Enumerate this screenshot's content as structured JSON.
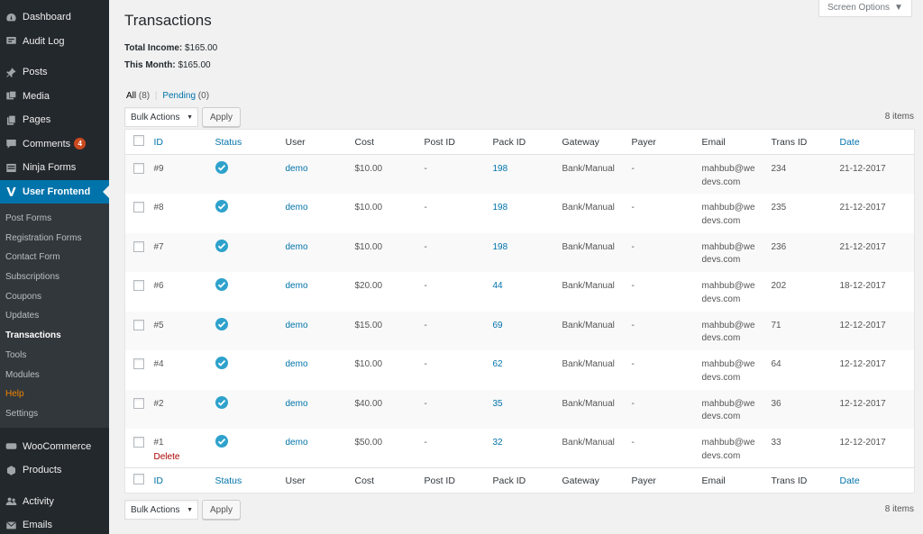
{
  "sidebar": {
    "items_top": [
      {
        "label": "Dashboard",
        "icon": "dashboard-icon"
      },
      {
        "label": "Audit Log",
        "icon": "audit-log-icon"
      }
    ],
    "items_mid": [
      {
        "label": "Posts",
        "icon": "pin-icon"
      },
      {
        "label": "Media",
        "icon": "media-icon"
      },
      {
        "label": "Pages",
        "icon": "pages-icon"
      },
      {
        "label": "Comments",
        "icon": "comment-icon",
        "badge": "4"
      },
      {
        "label": "Ninja Forms",
        "icon": "form-icon"
      },
      {
        "label": "User Frontend",
        "icon": "user-frontend-icon"
      }
    ],
    "submenu": [
      "Post Forms",
      "Registration Forms",
      "Contact Form",
      "Subscriptions",
      "Coupons",
      "Updates",
      "Transactions",
      "Tools",
      "Modules",
      "Help",
      "Settings"
    ],
    "items_bottom": [
      {
        "label": "WooCommerce",
        "icon": "woocommerce-icon"
      },
      {
        "label": "Products",
        "icon": "products-icon"
      }
    ],
    "items_end": [
      {
        "label": "Activity",
        "icon": "activity-icon"
      },
      {
        "label": "Emails",
        "icon": "email-icon"
      }
    ]
  },
  "header": {
    "title": "Transactions",
    "screen_options": "Screen Options"
  },
  "summary": {
    "total_label": "Total Income:",
    "total_value": "$165.00",
    "month_label": "This Month:",
    "month_value": "$165.00"
  },
  "filters": {
    "all": "All",
    "all_count": "(8)",
    "sep": "|",
    "pending": "Pending",
    "pending_count": "(0)"
  },
  "tablenav": {
    "bulk_actions": "Bulk Actions",
    "apply": "Apply",
    "count": "8 items"
  },
  "table": {
    "columns": [
      "ID",
      "Status",
      "User",
      "Cost",
      "Post ID",
      "Pack ID",
      "Gateway",
      "Payer",
      "Email",
      "Trans ID",
      "Date"
    ],
    "rows": [
      {
        "id": "#9",
        "user": "demo",
        "cost": "$10.00",
        "post_id": "-",
        "pack_id": "198",
        "gateway": "Bank/Manual",
        "payer": "-",
        "email1": "mahbub@we",
        "email2": "devs.com",
        "trans_id": "234",
        "date": "21-12-2017"
      },
      {
        "id": "#8",
        "user": "demo",
        "cost": "$10.00",
        "post_id": "-",
        "pack_id": "198",
        "gateway": "Bank/Manual",
        "payer": "-",
        "email1": "mahbub@we",
        "email2": "devs.com",
        "trans_id": "235",
        "date": "21-12-2017"
      },
      {
        "id": "#7",
        "user": "demo",
        "cost": "$10.00",
        "post_id": "-",
        "pack_id": "198",
        "gateway": "Bank/Manual",
        "payer": "-",
        "email1": "mahbub@we",
        "email2": "devs.com",
        "trans_id": "236",
        "date": "21-12-2017"
      },
      {
        "id": "#6",
        "user": "demo",
        "cost": "$20.00",
        "post_id": "-",
        "pack_id": "44",
        "gateway": "Bank/Manual",
        "payer": "-",
        "email1": "mahbub@we",
        "email2": "devs.com",
        "trans_id": "202",
        "date": "18-12-2017"
      },
      {
        "id": "#5",
        "user": "demo",
        "cost": "$15.00",
        "post_id": "-",
        "pack_id": "69",
        "gateway": "Bank/Manual",
        "payer": "-",
        "email1": "mahbub@we",
        "email2": "devs.com",
        "trans_id": "71",
        "date": "12-12-2017"
      },
      {
        "id": "#4",
        "user": "demo",
        "cost": "$10.00",
        "post_id": "-",
        "pack_id": "62",
        "gateway": "Bank/Manual",
        "payer": "-",
        "email1": "mahbub@we",
        "email2": "devs.com",
        "trans_id": "64",
        "date": "12-12-2017"
      },
      {
        "id": "#2",
        "user": "demo",
        "cost": "$40.00",
        "post_id": "-",
        "pack_id": "35",
        "gateway": "Bank/Manual",
        "payer": "-",
        "email1": "mahbub@we",
        "email2": "devs.com",
        "trans_id": "36",
        "date": "12-12-2017"
      },
      {
        "id": "#1",
        "user": "demo",
        "cost": "$50.00",
        "post_id": "-",
        "pack_id": "32",
        "gateway": "Bank/Manual",
        "payer": "-",
        "email1": "mahbub@we",
        "email2": "devs.com",
        "trans_id": "33",
        "date": "12-12-2017",
        "action": "Delete"
      }
    ]
  },
  "colors": {
    "sidebar_bg": "#23282d",
    "accent": "#0073aa",
    "status_check": "#2ea2cc",
    "badge": "#ca4a1f",
    "help": "#f18500",
    "delete": "#aa0000"
  }
}
